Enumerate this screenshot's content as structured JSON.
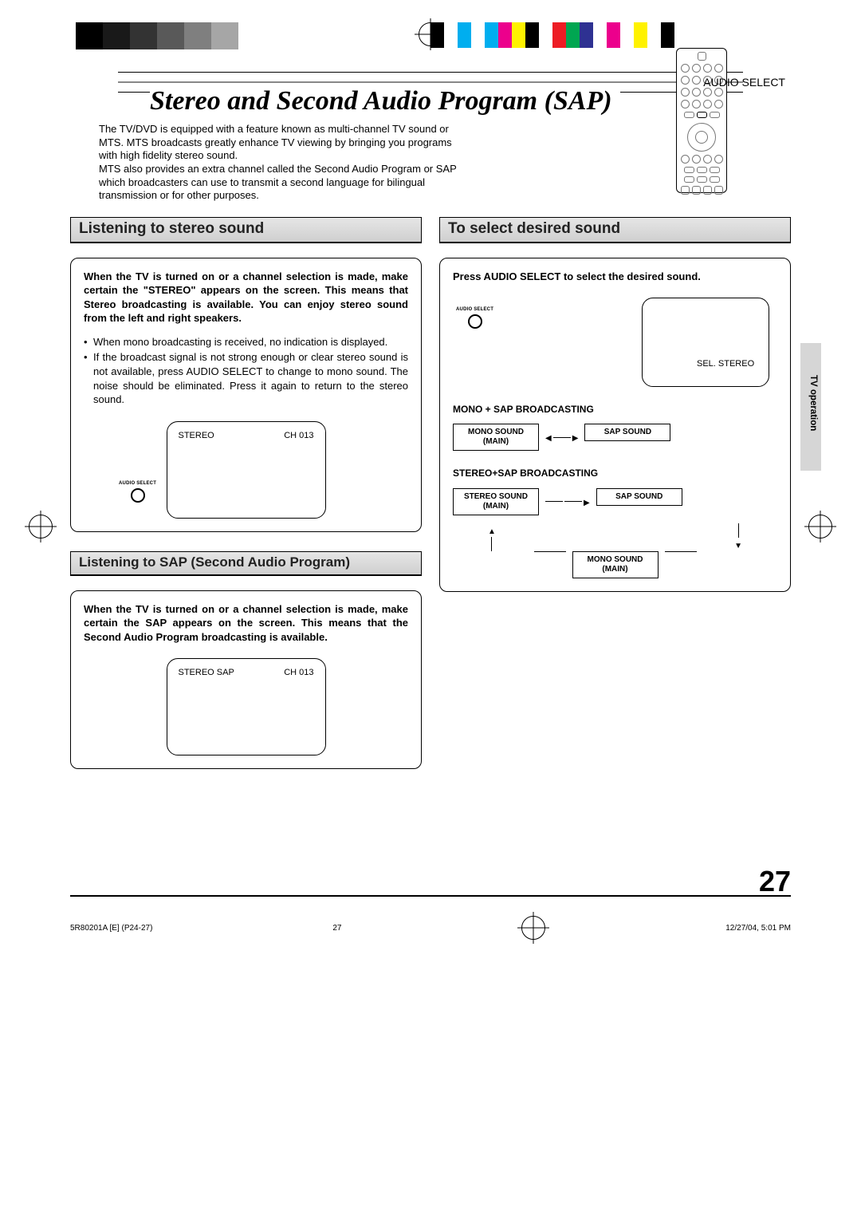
{
  "page_title": "Stereo and Second Audio Program (SAP)",
  "intro_p1": "The TV/DVD is equipped with a feature known as multi-channel TV sound or MTS. MTS broadcasts greatly enhance TV viewing by bringing you programs with high fidelity stereo sound.",
  "intro_p2": "MTS also provides an extra channel called the Second Audio Program or SAP which broadcasters can use to transmit a second language for bilingual transmission or for other purposes.",
  "remote_label": "AUDIO SELECT",
  "side_tab": "TV operation",
  "sections": {
    "stereo": {
      "heading": "Listening to stereo sound",
      "bold": "When the TV is turned on or a channel selection is made, make certain the \"STEREO\" appears on the screen. This means that Stereo broadcasting is available. You can enjoy stereo sound from the left and right speakers.",
      "bullet1": "When mono broadcasting is received, no indication is displayed.",
      "bullet2": "If the broadcast signal is not strong enough or clear stereo sound is not available, press AUDIO SELECT to change to mono sound. The noise should be eliminated. Press it again to return to the stereo sound.",
      "tv_left": "STEREO",
      "tv_right": "CH 013",
      "icon_label": "AUDIO SELECT"
    },
    "sap": {
      "heading": "Listening to SAP (Second Audio Program)",
      "bold": "When the TV is turned on or a channel selection is made, make certain the SAP appears on the screen. This means that the Second Audio Program broadcasting is available.",
      "tv_left": "STEREO  SAP",
      "tv_right": "CH 013"
    },
    "select": {
      "heading": "To select desired sound",
      "instruction": "Press AUDIO SELECT to select the desired sound.",
      "icon_label": "AUDIO SELECT",
      "sel_label": "SEL. STEREO",
      "mono_sap_heading": "MONO + SAP BROADCASTING",
      "mono_main": "MONO SOUND\n(MAIN)",
      "sap_sound": "SAP SOUND",
      "stereo_sap_heading": "STEREO+SAP BROADCASTING",
      "stereo_main": "STEREO SOUND\n(MAIN)",
      "mono_main2": "MONO SOUND\n(MAIN)"
    }
  },
  "page_number": "27",
  "footer": {
    "left": "5R80201A [E] (P24-27)",
    "center": "27",
    "right": "12/27/04, 5:01 PM"
  }
}
